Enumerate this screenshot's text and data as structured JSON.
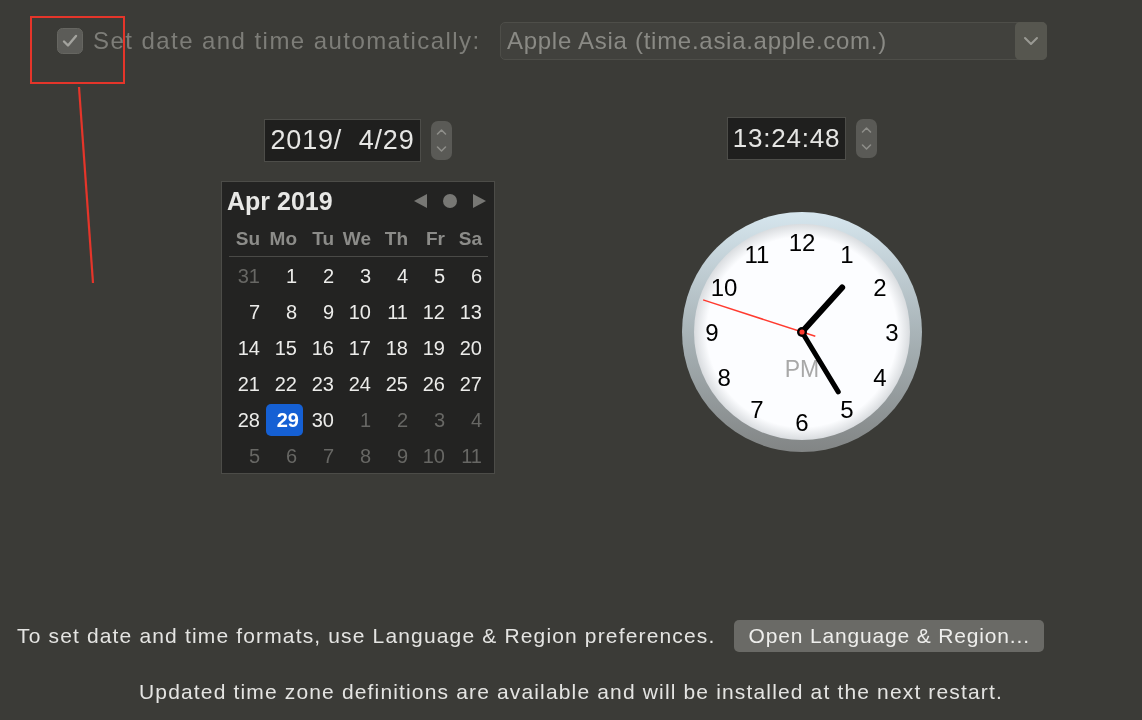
{
  "auto_time": {
    "label": "Set date and time automatically:",
    "checked": true,
    "disabled": true
  },
  "time_server": {
    "value": "Apple Asia (time.asia.apple.com.)",
    "disabled": true
  },
  "date_field": {
    "value": "2019/  4/29"
  },
  "time_field": {
    "value": "13:24:48"
  },
  "calendar": {
    "title": "Apr 2019",
    "weekdays": [
      "Su",
      "Mo",
      "Tu",
      "We",
      "Th",
      "Fr",
      "Sa"
    ],
    "weeks": [
      [
        {
          "day": "31",
          "in_month": false,
          "selected": false
        },
        {
          "day": "1",
          "in_month": true,
          "selected": false
        },
        {
          "day": "2",
          "in_month": true,
          "selected": false
        },
        {
          "day": "3",
          "in_month": true,
          "selected": false
        },
        {
          "day": "4",
          "in_month": true,
          "selected": false
        },
        {
          "day": "5",
          "in_month": true,
          "selected": false
        },
        {
          "day": "6",
          "in_month": true,
          "selected": false
        }
      ],
      [
        {
          "day": "7",
          "in_month": true,
          "selected": false
        },
        {
          "day": "8",
          "in_month": true,
          "selected": false
        },
        {
          "day": "9",
          "in_month": true,
          "selected": false
        },
        {
          "day": "10",
          "in_month": true,
          "selected": false
        },
        {
          "day": "11",
          "in_month": true,
          "selected": false
        },
        {
          "day": "12",
          "in_month": true,
          "selected": false
        },
        {
          "day": "13",
          "in_month": true,
          "selected": false
        }
      ],
      [
        {
          "day": "14",
          "in_month": true,
          "selected": false
        },
        {
          "day": "15",
          "in_month": true,
          "selected": false
        },
        {
          "day": "16",
          "in_month": true,
          "selected": false
        },
        {
          "day": "17",
          "in_month": true,
          "selected": false
        },
        {
          "day": "18",
          "in_month": true,
          "selected": false
        },
        {
          "day": "19",
          "in_month": true,
          "selected": false
        },
        {
          "day": "20",
          "in_month": true,
          "selected": false
        }
      ],
      [
        {
          "day": "21",
          "in_month": true,
          "selected": false
        },
        {
          "day": "22",
          "in_month": true,
          "selected": false
        },
        {
          "day": "23",
          "in_month": true,
          "selected": false
        },
        {
          "day": "24",
          "in_month": true,
          "selected": false
        },
        {
          "day": "25",
          "in_month": true,
          "selected": false
        },
        {
          "day": "26",
          "in_month": true,
          "selected": false
        },
        {
          "day": "27",
          "in_month": true,
          "selected": false
        }
      ],
      [
        {
          "day": "28",
          "in_month": true,
          "selected": false
        },
        {
          "day": "29",
          "in_month": true,
          "selected": true
        },
        {
          "day": "30",
          "in_month": true,
          "selected": false
        },
        {
          "day": "1",
          "in_month": false,
          "selected": false
        },
        {
          "day": "2",
          "in_month": false,
          "selected": false
        },
        {
          "day": "3",
          "in_month": false,
          "selected": false
        },
        {
          "day": "4",
          "in_month": false,
          "selected": false
        }
      ],
      [
        {
          "day": "5",
          "in_month": false,
          "selected": false
        },
        {
          "day": "6",
          "in_month": false,
          "selected": false
        },
        {
          "day": "7",
          "in_month": false,
          "selected": false
        },
        {
          "day": "8",
          "in_month": false,
          "selected": false
        },
        {
          "day": "9",
          "in_month": false,
          "selected": false
        },
        {
          "day": "10",
          "in_month": false,
          "selected": false
        },
        {
          "day": "11",
          "in_month": false,
          "selected": false
        }
      ]
    ]
  },
  "clock": {
    "numbers": [
      "12",
      "1",
      "2",
      "3",
      "4",
      "5",
      "6",
      "7",
      "8",
      "9",
      "10",
      "11"
    ],
    "period": "PM"
  },
  "formats_note": "To set date and time formats, use Language & Region preferences.",
  "open_region_button": "Open Language & Region...",
  "update_notice": "Updated time zone definitions are available and will be installed at the next restart."
}
